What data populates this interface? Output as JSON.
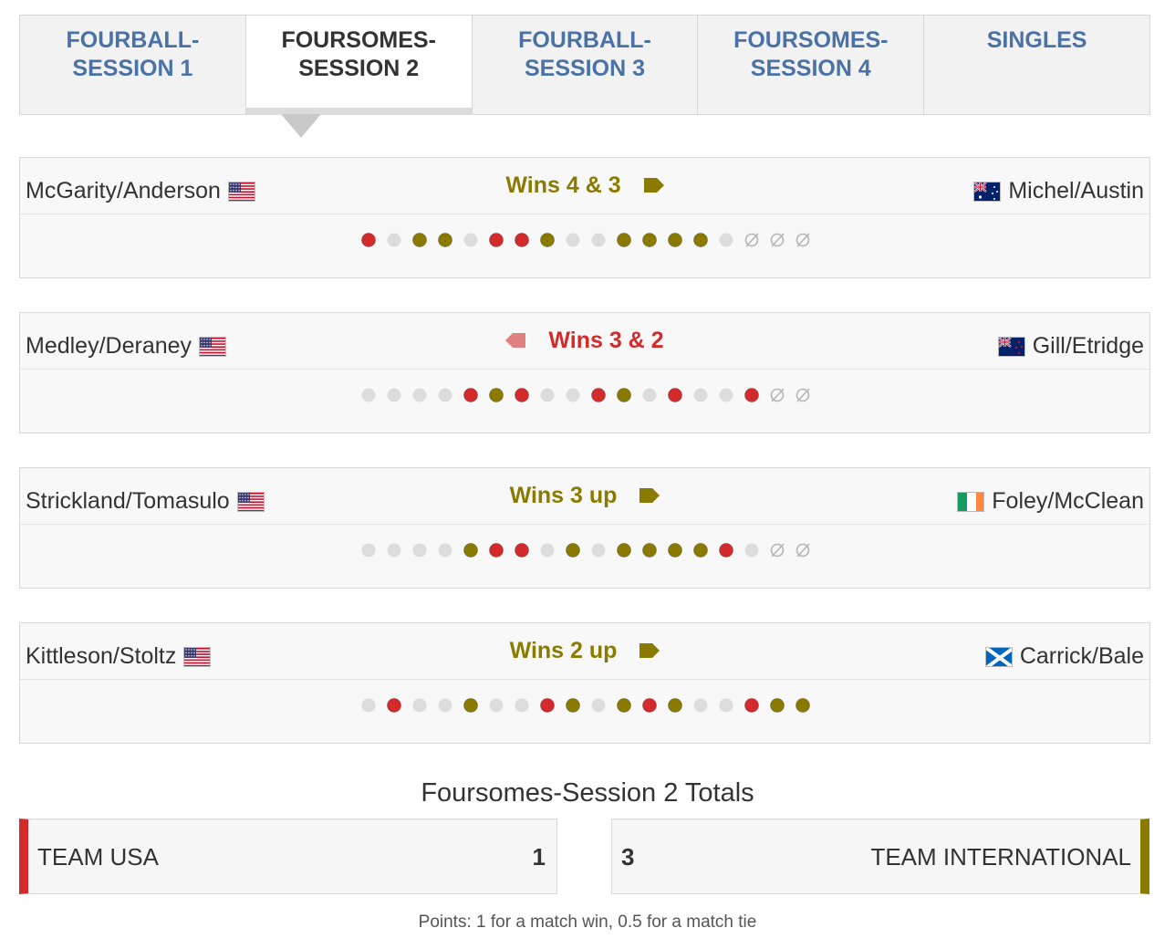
{
  "tabs": [
    {
      "line1": "FOURBALL-",
      "line2": "SESSION 1",
      "active": false
    },
    {
      "line1": "FOURSOMES-",
      "line2": "SESSION 2",
      "active": true
    },
    {
      "line1": "FOURBALL-",
      "line2": "SESSION 3",
      "active": false
    },
    {
      "line1": "FOURSOMES-",
      "line2": "SESSION 4",
      "active": false
    },
    {
      "line1": "SINGLES",
      "line2": "",
      "active": false
    }
  ],
  "matches": [
    {
      "left_player": "McGarity/Anderson",
      "left_flag": "usa",
      "right_player": "Michel/Austin",
      "right_flag": "australia",
      "result": "Wins 4 & 3",
      "winner": "intl",
      "holes": [
        "usa",
        "halved",
        "intl",
        "intl",
        "halved",
        "usa",
        "usa",
        "intl",
        "halved",
        "halved",
        "intl",
        "intl",
        "intl",
        "intl",
        "halved",
        "unplayed",
        "unplayed",
        "unplayed"
      ]
    },
    {
      "left_player": "Medley/Deraney",
      "left_flag": "usa",
      "right_player": "Gill/Etridge",
      "right_flag": "newzealand",
      "result": "Wins 3 & 2",
      "winner": "usa",
      "holes": [
        "halved",
        "halved",
        "halved",
        "halved",
        "usa",
        "intl",
        "usa",
        "halved",
        "halved",
        "usa",
        "intl",
        "halved",
        "usa",
        "halved",
        "halved",
        "usa",
        "unplayed",
        "unplayed"
      ]
    },
    {
      "left_player": "Strickland/Tomasulo",
      "left_flag": "usa",
      "right_player": "Foley/McClean",
      "right_flag": "ireland",
      "result": "Wins 3 up",
      "winner": "intl",
      "holes": [
        "halved",
        "halved",
        "halved",
        "halved",
        "intl",
        "usa",
        "usa",
        "halved",
        "intl",
        "halved",
        "intl",
        "intl",
        "intl",
        "intl",
        "usa",
        "halved",
        "unplayed",
        "unplayed"
      ]
    },
    {
      "left_player": "Kittleson/Stoltz",
      "left_flag": "usa",
      "right_player": "Carrick/Bale",
      "right_flag": "scotland",
      "result": "Wins 2 up",
      "winner": "intl",
      "holes": [
        "halved",
        "usa",
        "halved",
        "halved",
        "intl",
        "halved",
        "halved",
        "usa",
        "intl",
        "halved",
        "intl",
        "usa",
        "intl",
        "halved",
        "halved",
        "usa",
        "intl",
        "intl"
      ]
    }
  ],
  "totals": {
    "title": "Foursomes-Session 2 Totals",
    "usa_name": "TEAM USA",
    "usa_score": "1",
    "intl_name": "TEAM INTERNATIONAL",
    "intl_score": "3"
  },
  "footnote": "Points: 1 for a match win, 0.5 for a match tie",
  "colors": {
    "usa": "#d32b2b",
    "intl": "#8b7a00",
    "halved": "#dcdcdc",
    "link": "#4a72a6"
  }
}
